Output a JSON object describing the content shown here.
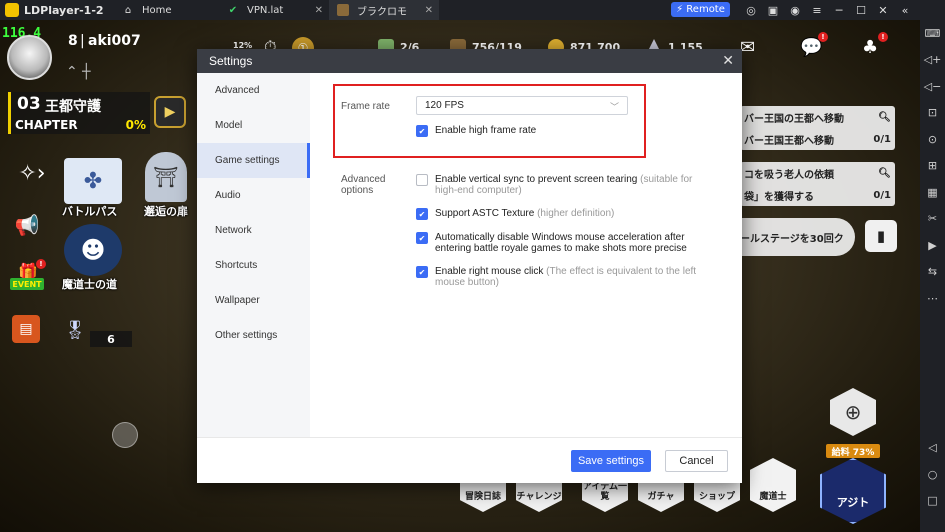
{
  "titlebar": {
    "app_title": "LDPlayer-1-2",
    "tabs": [
      {
        "label": "Home",
        "icon": "home-icon"
      },
      {
        "label": "VPN.lat",
        "icon": "shield-icon"
      },
      {
        "label": "ブラクロモ",
        "icon": "game-icon"
      }
    ],
    "remote_label": "Remote"
  },
  "game": {
    "fps": "116.4",
    "player": {
      "level": "8",
      "name": "aki007"
    },
    "stage": {
      "number": "03",
      "title": "王都守護",
      "chapter_label": "CHAPTER",
      "chapter_progress": "0%"
    },
    "left_menu": {
      "battle_pass": "バトルパス",
      "encounter_door": "邂逅の扉",
      "mage_path": "魔道士の道",
      "event_badge": "EVENT",
      "medal_count": "6"
    },
    "resources": {
      "percent_12": "12%",
      "tickets": "2/6",
      "stamina": "756/119",
      "gold": "871,700",
      "gems": "1,155"
    },
    "quests": [
      {
        "title": "バー王国の王都へ移動",
        "sub": "バー王国王都へ移動",
        "progress": "0/1"
      },
      {
        "title": "コを吸う老人の依頼",
        "sub": "袋」を獲得する",
        "progress": "0/1"
      }
    ],
    "stage_banner": "ールステージを30回ク",
    "salary_label": "給料 73%",
    "agito_label": "アジト",
    "bottom_menu": [
      "冒険日誌",
      "チャレンジ",
      "アイテム一覧",
      "ガチャ",
      "ショップ",
      "魔道士"
    ]
  },
  "settings": {
    "title": "Settings",
    "nav": [
      "Advanced",
      "Model",
      "Game settings",
      "Audio",
      "Network",
      "Shortcuts",
      "Wallpaper",
      "Other settings"
    ],
    "frame_rate_label": "Frame rate",
    "frame_rate_value": "120 FPS",
    "high_frame_rate_label": "Enable high frame rate",
    "advanced_label_1": "Advanced",
    "advanced_label_2": "options",
    "options": [
      {
        "text": "Enable vertical sync to prevent screen tearing",
        "hint": "(suitable for high-end computer)",
        "checked": false
      },
      {
        "text": "Support ASTC Texture",
        "hint": "(higher definition)",
        "checked": true
      },
      {
        "text": "Automatically disable Windows mouse acceleration after entering battle royale games to make shots more precise",
        "hint": "",
        "checked": true
      },
      {
        "text": "Enable right mouse click",
        "hint": "(The effect is equivalent to the left mouse button)",
        "checked": true
      }
    ],
    "save_label": "Save settings",
    "cancel_label": "Cancel"
  },
  "colors": {
    "accent": "#3b6cf5",
    "highlight": "#e02020",
    "header": "#3a3d44"
  }
}
